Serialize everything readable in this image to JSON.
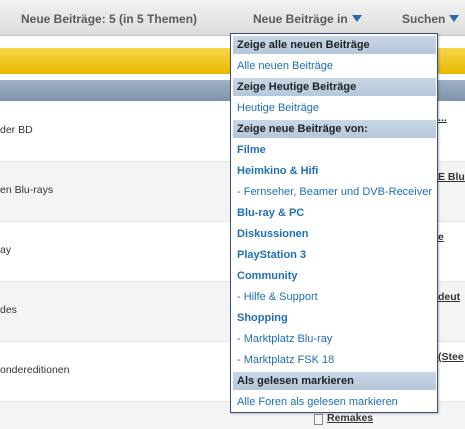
{
  "nav": {
    "new_posts": "Neue Beiträge: 5 (in 5 Themen)",
    "new_posts_in": "Neue Beiträge in",
    "search": "Suchen"
  },
  "rows": [
    {
      "text": "der BD"
    },
    {
      "text": "en Blu-rays"
    },
    {
      "text": "ay"
    },
    {
      "text": "des"
    },
    {
      "text": "ondereditionen"
    },
    {
      "text": ""
    }
  ],
  "right_fragments": {
    "r1": "...",
    "r2": "E Blu-",
    "r3": "e",
    "r4": "deut",
    "r5": "(Stee",
    "r6": "Remakes"
  },
  "menu": {
    "h_all": "Zeige alle neuen Beiträge",
    "all_new": "Alle neuen Beiträge",
    "h_today": "Zeige Heutige Beiträge",
    "today": "Heutige Beiträge",
    "h_from": "Zeige neue Beiträge von:",
    "filme": "Filme",
    "heimkino": "Heimkino & Hifi",
    "tv": "- Fernseher, Beamer und DVB-Receiver",
    "bluray": "Blu-ray & PC",
    "diskussionen": "Diskussionen",
    "ps3": "PlayStation 3",
    "community": "Community",
    "hilfe": "- Hilfe & Support",
    "shopping": "Shopping",
    "mp_bluray": "- Marktplatz Blu-ray",
    "mp_fsk": "- Marktplatz FSK 18",
    "h_read": "Als gelesen markieren",
    "mark_all": "Alle Foren als gelesen markieren"
  }
}
